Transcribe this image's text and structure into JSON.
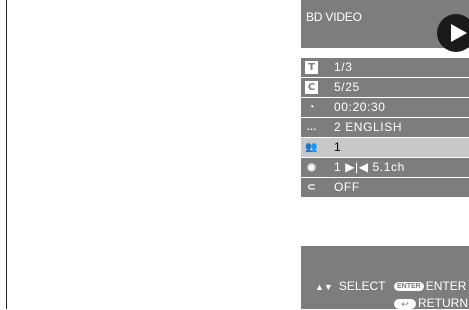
{
  "header": {
    "title": "BD VIDEO",
    "play_icon": "play-icon"
  },
  "rows": [
    {
      "icon": "title-icon",
      "glyph": "T",
      "value": "1/3"
    },
    {
      "icon": "chapter-icon",
      "glyph": "C",
      "value": "5/25"
    },
    {
      "icon": "clock-icon",
      "glyph": "◔",
      "value": "00:20:30"
    },
    {
      "icon": "subtitle-icon",
      "glyph": "…",
      "value": "2 ENGLISH"
    },
    {
      "icon": "angle-icon",
      "glyph": "👥",
      "value": "1"
    },
    {
      "icon": "audio-icon",
      "glyph": "◉",
      "value": "1  ▶|◀  5.1ch"
    },
    {
      "icon": "repeat-icon",
      "glyph": "⊂",
      "value": "OFF"
    }
  ],
  "footer": {
    "select_label": "SELECT",
    "enter_key": "ENTER",
    "enter_label": "ENTER",
    "return_label": "RETURN"
  },
  "colors": {
    "panel": "#7d7d7d",
    "selected_row": "#c8c8c8",
    "text": "#ffffff"
  }
}
